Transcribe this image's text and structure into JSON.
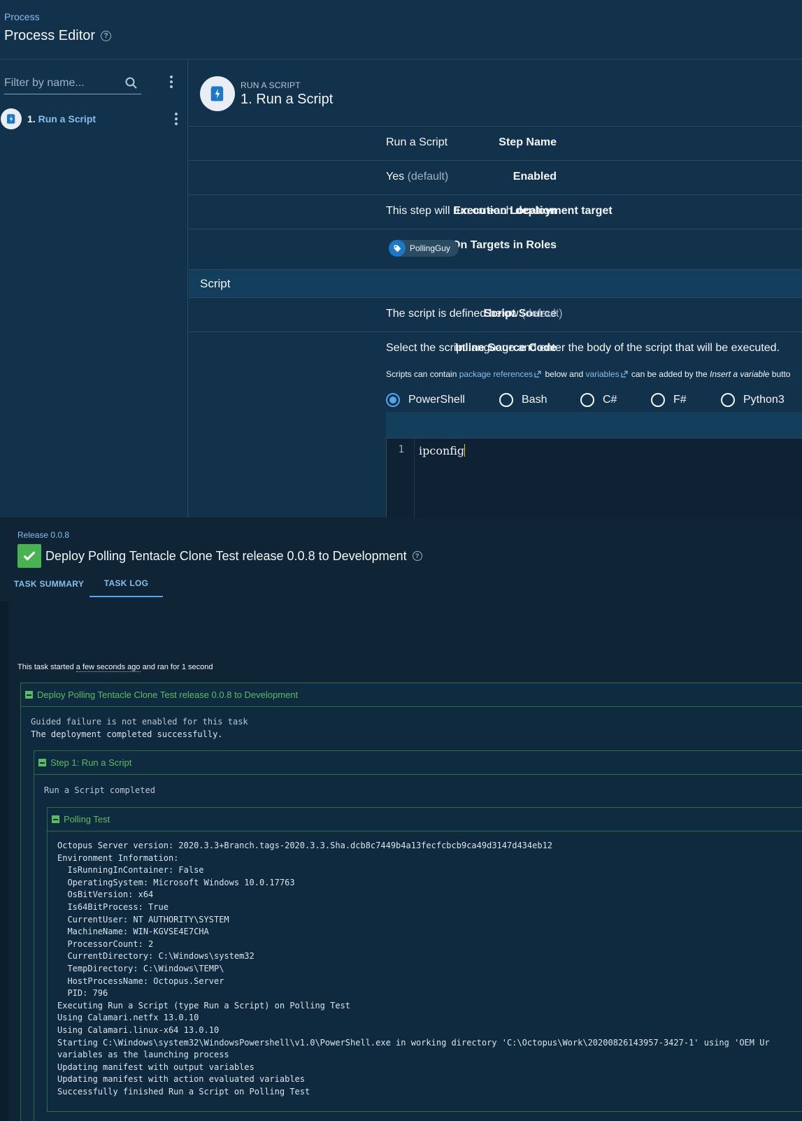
{
  "editor": {
    "breadcrumb": "Process",
    "title": "Process Editor",
    "help_glyph": "?",
    "filter": {
      "placeholder": "Filter by name..."
    },
    "steps": [
      {
        "number": "1.",
        "name": "Run a Script"
      }
    ],
    "step_header": {
      "kicker": "RUN A SCRIPT",
      "number": "1.",
      "title": "Run a Script"
    },
    "fields": {
      "step_name": {
        "label": "Step Name",
        "value": "Run a Script"
      },
      "enabled": {
        "label": "Enabled",
        "value": "Yes",
        "suffix": "(default)"
      },
      "execution_location": {
        "label": "Execution Location",
        "value": "This step will run on each",
        "emphasis": "deployment target"
      },
      "roles": {
        "label": "On Targets in Roles",
        "chip": "PollingGuy"
      }
    },
    "script_section": {
      "title": "Script",
      "source": {
        "label": "Script Source",
        "value": "The script is defined below",
        "suffix": "(default)"
      },
      "inline": {
        "label": "Inline Source Code",
        "description": "Select the script language and enter the body of the script that will be executed.",
        "hint_prefix": "Scripts can contain",
        "hint_link1": "package references",
        "hint_mid": "below and",
        "hint_link2": "variables",
        "hint_mid2": "can be added by the",
        "hint_em": "Insert a variable",
        "hint_suffix": "butto"
      },
      "languages": [
        "PowerShell",
        "Bash",
        "C#",
        "F#",
        "Python3"
      ],
      "selected_language": "PowerShell",
      "code": {
        "line_number": "1",
        "text": "ipconfig"
      }
    }
  },
  "tasklog": {
    "release": "Release 0.0.8",
    "title": "Deploy Polling Tentacle Clone Test release 0.0.8 to Development",
    "help_glyph": "?",
    "tabs": [
      "TASK SUMMARY",
      "TASK LOG"
    ],
    "active_tab": "TASK LOG",
    "started": {
      "prefix": "This task started",
      "when": "a few seconds ago",
      "mid": "and ran for",
      "duration": "1 second"
    },
    "deploy_block": {
      "title": "Deploy Polling Tentacle Clone Test release 0.0.8 to Development",
      "lines": [
        "Guided failure is not enabled for this task",
        "The deployment completed successfully."
      ]
    },
    "step_block": {
      "title": "Step 1: Run a Script",
      "lines": [
        "Run a Script completed"
      ]
    },
    "polling_block": {
      "title": "Polling Test",
      "lines": [
        "Octopus Server version: 2020.3.3+Branch.tags-2020.3.3.Sha.dcb8c7449b4a13fecfcbcb9ca49d3147d434eb12",
        "Environment Information:",
        "  IsRunningInContainer: False",
        "  OperatingSystem: Microsoft Windows 10.0.17763",
        "  OsBitVersion: x64",
        "  Is64BitProcess: True",
        "  CurrentUser: NT AUTHORITY\\SYSTEM",
        "  MachineName: WIN-KGVSE4E7CHA",
        "  ProcessorCount: 2",
        "  CurrentDirectory: C:\\Windows\\system32",
        "  TempDirectory: C:\\Windows\\TEMP\\",
        "  HostProcessName: Octopus.Server",
        "  PID: 796",
        "Executing Run a Script (type Run a Script) on Polling Test",
        "Using Calamari.netfx 13.0.10",
        "Using Calamari.linux-x64 13.0.10",
        "Starting C:\\Windows\\system32\\WindowsPowershell\\v1.0\\PowerShell.exe in working directory 'C:\\Octopus\\Work\\20200826143957-3427-1' using 'OEM Ur",
        "variables as the launching process",
        "Updating manifest with output variables",
        "Updating manifest with action evaluated variables",
        "Successfully finished Run a Script on Polling Test"
      ]
    }
  },
  "colors": {
    "background": "#11324a",
    "link": "#87bfec",
    "accent": "#50a5ec",
    "success": "#48b350",
    "log_green": "#5bbd61"
  }
}
